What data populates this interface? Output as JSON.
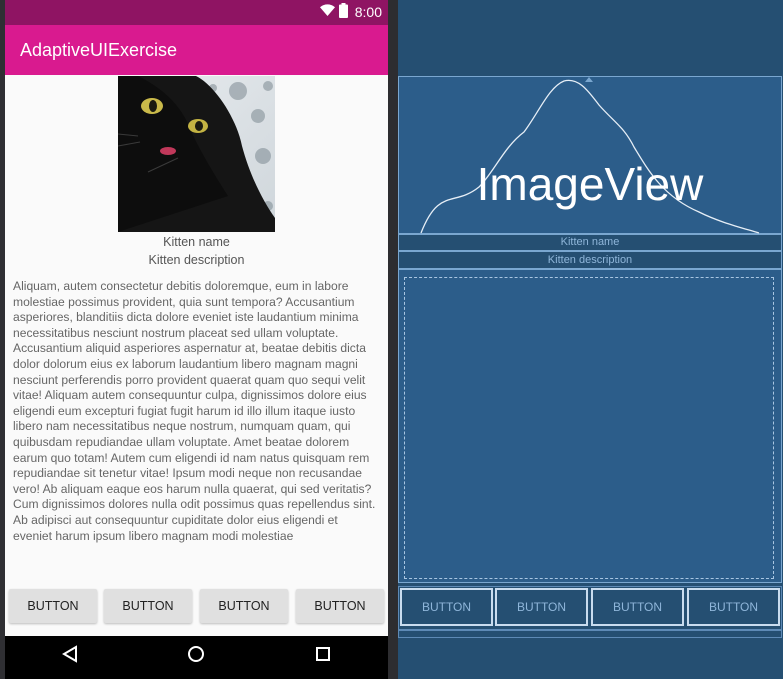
{
  "status_bar": {
    "time": "8:00"
  },
  "app_bar": {
    "title": "AdaptiveUIExercise"
  },
  "kitten": {
    "name": "Kitten name",
    "description": "Kitten description"
  },
  "body_text": "Aliquam, autem consectetur debitis doloremque, eum in labore molestiae possimus provident, quia sunt tempora? Accusantium asperiores, blanditiis dicta dolore eveniet iste laudantium minima necessitatibus nesciunt nostrum placeat sed ullam voluptate. Accusantium aliquid asperiores aspernatur at, beatae debitis dicta dolor dolorum eius ex laborum laudantium libero magnam magni nesciunt perferendis porro provident quaerat quam quo sequi velit vitae! Aliquam autem consequuntur culpa, dignissimos dolore eius eligendi eum excepturi fugiat fugit harum id illo illum itaque iusto libero nam necessitatibus neque nostrum, numquam quam, qui quibusdam repudiandae ullam voluptate. Amet beatae dolorem earum quo totam! Autem cum eligendi id nam natus quisquam rem repudiandae sit tenetur vitae! Ipsum modi neque non recusandae vero! Ab aliquam eaque eos harum nulla quaerat, qui sed veritatis? Cum dignissimos dolores nulla odit possimus quas repellendus sint. Ab adipisci aut consequuntur cupiditate dolor eius eligendi et eveniet harum ipsum libero magnam modi molestiae",
  "buttons": [
    "BUTTON",
    "BUTTON",
    "BUTTON",
    "BUTTON"
  ],
  "blueprint": {
    "image_label": "ImageView",
    "name_label": "Kitten name",
    "description_label": "Kitten description",
    "buttons": [
      "BUTTON",
      "BUTTON",
      "BUTTON",
      "BUTTON"
    ]
  },
  "colors": {
    "status_bar": "#8f1463",
    "app_bar": "#d91a8f",
    "blueprint_bg": "#254f72",
    "blueprint_box": "#2c5d8a",
    "blueprint_line": "#7aa7d0",
    "button_bg": "#e0e0e0"
  }
}
